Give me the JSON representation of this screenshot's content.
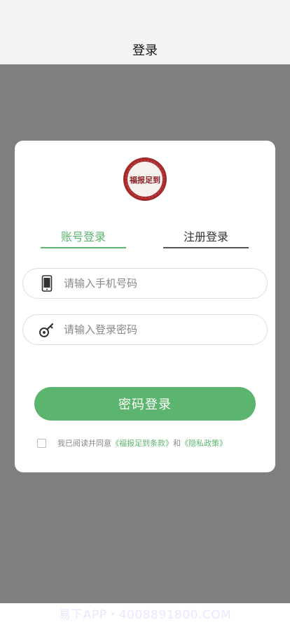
{
  "header": {
    "title": "登录"
  },
  "logo": {
    "text": "福报足到"
  },
  "tabs": [
    {
      "label": "账号登录",
      "active": true
    },
    {
      "label": "注册登录",
      "active": false
    }
  ],
  "form": {
    "phone": {
      "placeholder": "请输入手机号码",
      "value": ""
    },
    "password": {
      "placeholder": "请输入登录密码",
      "value": ""
    },
    "submit_label": "密码登录"
  },
  "agreement": {
    "checked": false,
    "prefix": "我已阅读并同意",
    "terms_link": "《福报足到条款》",
    "and": "和",
    "privacy_link": "《隐私政策》"
  },
  "watermark": "易下APP・4008891800.COM",
  "colors": {
    "accent": "#5cb56e",
    "seal": "#a3292b",
    "overlay": "#7f7f7f"
  },
  "icons": {
    "phone": "phone-icon",
    "password": "key-icon"
  }
}
